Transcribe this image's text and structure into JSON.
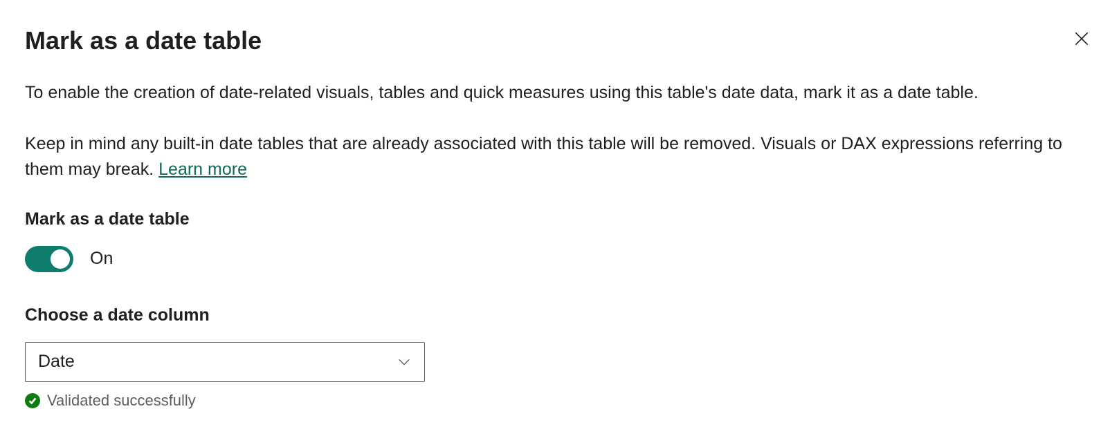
{
  "dialog": {
    "title": "Mark as a date table",
    "description": "To enable the creation of date-related visuals, tables and quick measures using this table's date data, mark it as a date table.",
    "warning": "Keep in mind any built-in date tables that are already associated with this table will be removed. Visuals or DAX expressions referring to them may break. ",
    "learn_more": "Learn more"
  },
  "toggle": {
    "section_label": "Mark as a date table",
    "state": "On"
  },
  "column_select": {
    "label": "Choose a date column",
    "value": "Date"
  },
  "validation": {
    "message": "Validated successfully"
  }
}
